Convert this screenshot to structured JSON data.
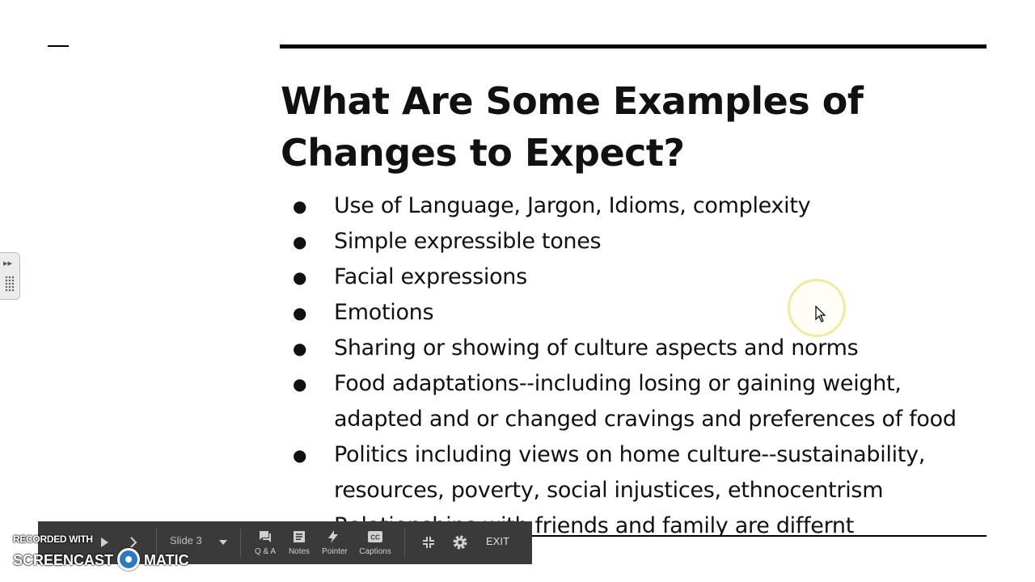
{
  "slide": {
    "title_line1": "What Are Some Examples of",
    "title_line2": "Changes to Expect?",
    "bullets": [
      "Use of Language, Jargon, Idioms, complexity",
      "Simple expressible tones",
      "Facial expressions",
      "Emotions",
      "Sharing or showing of culture aspects and norms",
      "Food adaptations--including losing or gaining weight, adapted and or changed cravings and preferences of food",
      "Politics including views on home culture--sustainability, resources, poverty, social injustices, ethnocentrism",
      "Relationships with friends and family are differnt"
    ]
  },
  "toolbar": {
    "slide_selector": "Slide 3",
    "qa_label": "Q & A",
    "notes_label": "Notes",
    "pointer_label": "Pointer",
    "captions_label": "Captions",
    "exit_label": "EXIT"
  },
  "watermark": {
    "top": "RECORDED WITH",
    "left": "SCREENCAST",
    "right": "MATIC"
  },
  "colors": {
    "toolbar_bg": "#3a3a3a",
    "cursor_highlight": "#f1eb9c",
    "watermark_logo": "#2a79c4"
  }
}
